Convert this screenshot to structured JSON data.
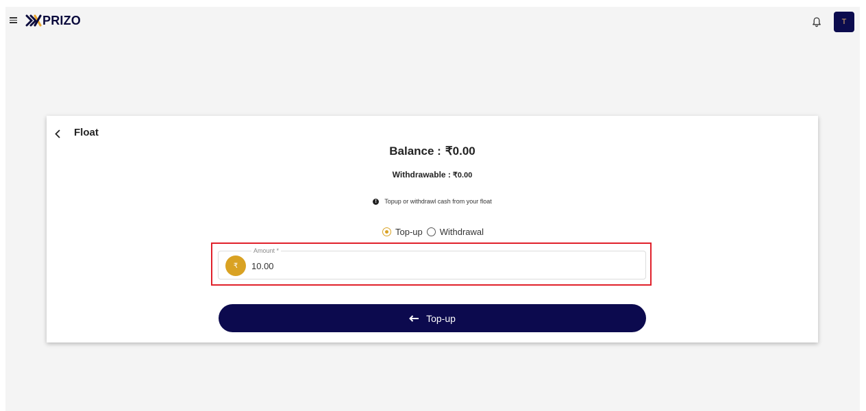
{
  "header": {
    "brand": "PRIZO",
    "avatar_initial": "T"
  },
  "card": {
    "title": "Float",
    "balance_label": "Balance :",
    "balance_value": "₹0.00",
    "withdrawable_label": "Withdrawable :",
    "withdrawable_value": "₹0.00",
    "info_text": "Topup or withdrawl cash from your float",
    "radio_options": [
      {
        "label": "Top-up",
        "selected": true
      },
      {
        "label": "Withdrawal",
        "selected": false
      }
    ],
    "amount": {
      "label": "Amount *",
      "currency_symbol": "₹",
      "value": "10.00"
    },
    "submit_label": "Top-up"
  },
  "colors": {
    "primary": "#0c0a4e",
    "accent": "#d9a223",
    "highlight": "#e0202a"
  },
  "icons": [
    "menu-icon",
    "bell-icon",
    "back-arrow-icon",
    "info-icon",
    "rupee-icon",
    "arrow-left-icon"
  ]
}
